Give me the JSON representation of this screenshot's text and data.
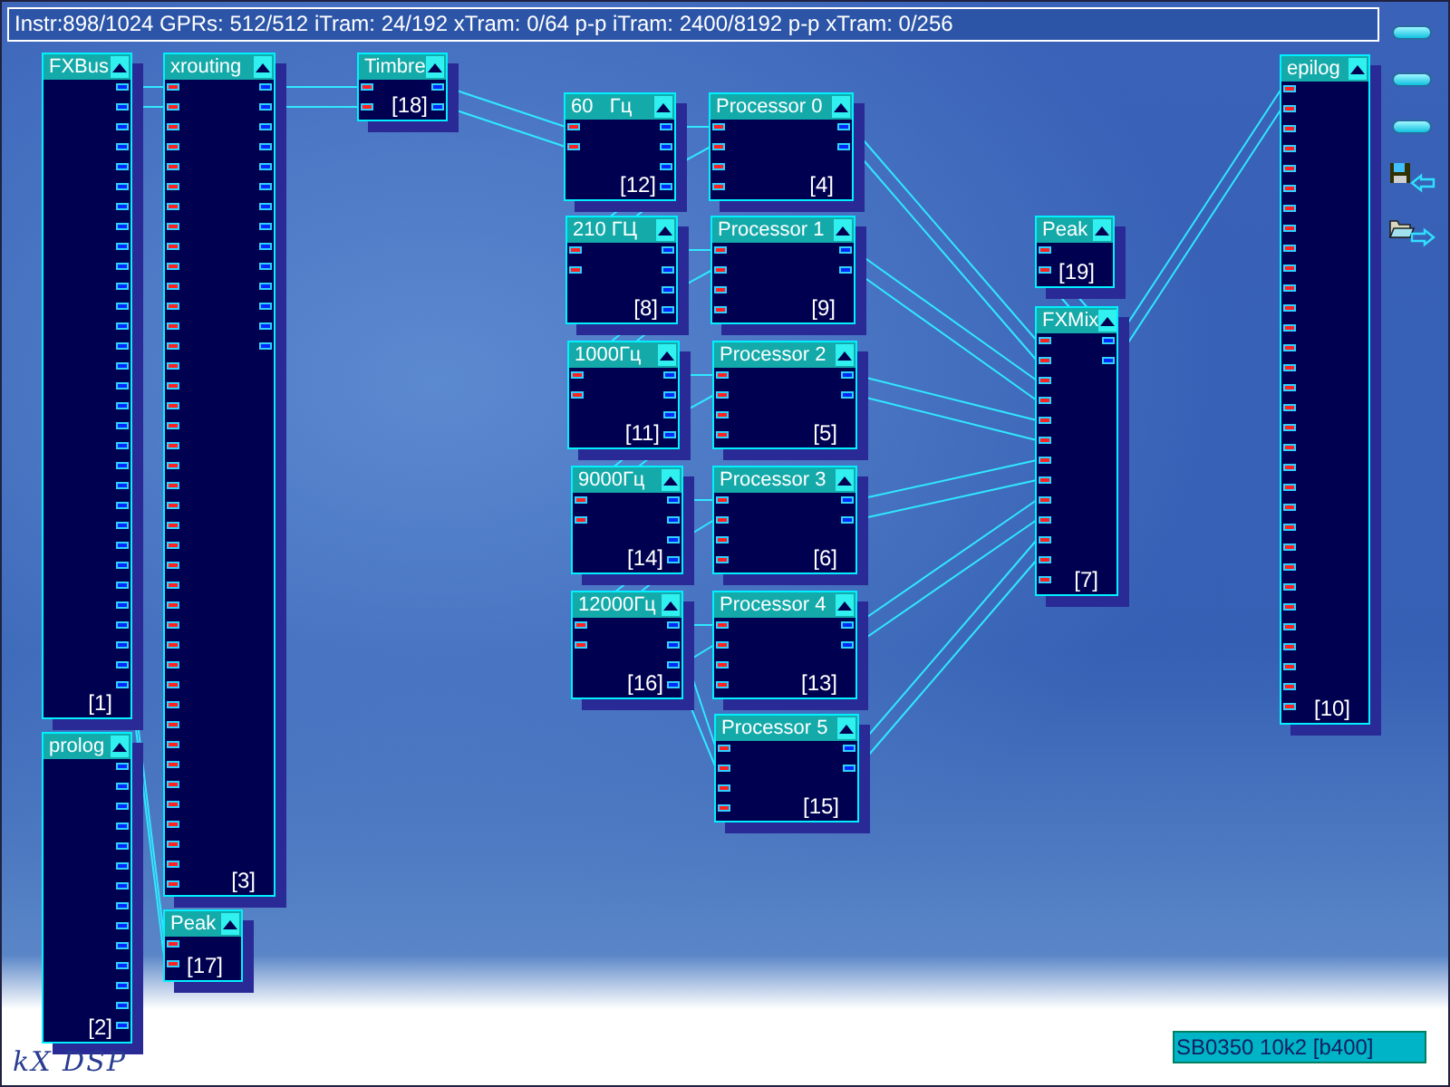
{
  "status_bar": {
    "text": "Instr:898/1024 GPRs: 512/512 iTram: 24/192 xTram: 0/64 p-p iTram: 2400/8192 p-p xTram: 0/256"
  },
  "nodes": [
    {
      "title": "FXBus",
      "number": "[1]"
    },
    {
      "title": "xrouting",
      "number": "[3]"
    },
    {
      "title": "Timbre",
      "number": "[18]"
    },
    {
      "title": "60   Гц",
      "number": "[12]"
    },
    {
      "title": "Processor 0",
      "number": "[4]"
    },
    {
      "title": "210 ГЦ",
      "number": "[8]"
    },
    {
      "title": "Processor 1",
      "number": "[9]"
    },
    {
      "title": "1000Гц",
      "number": "[11]"
    },
    {
      "title": "Processor 2",
      "number": "[5]"
    },
    {
      "title": "9000Гц",
      "number": "[14]"
    },
    {
      "title": "Processor 3",
      "number": "[6]"
    },
    {
      "title": "12000Гц",
      "number": "[16]"
    },
    {
      "title": "Processor 4",
      "number": "[13]"
    },
    {
      "title": "Processor 5",
      "number": "[15]"
    },
    {
      "title": "Peak",
      "number": "[19]"
    },
    {
      "title": "FXMix",
      "number": "[7]"
    },
    {
      "title": "epilog",
      "number": "[10]"
    },
    {
      "title": "prolog",
      "number": "[2]"
    },
    {
      "title": "Peak",
      "number": "[17]"
    }
  ],
  "footer": {
    "logo": "kX DSP",
    "device": "SB0350 10k2 [b400]"
  }
}
